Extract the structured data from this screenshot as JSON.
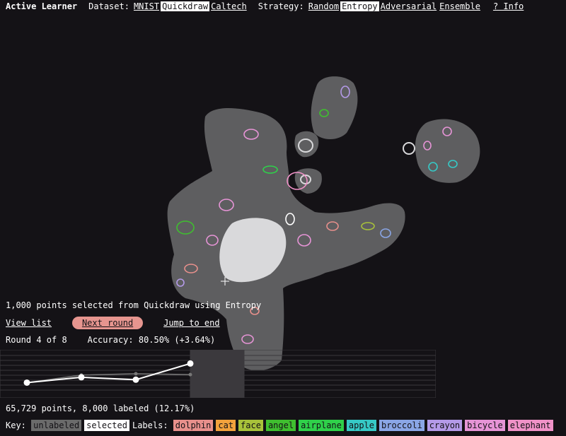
{
  "app": {
    "title": "Active Learner"
  },
  "dataset": {
    "label": "Dataset:",
    "options": [
      "MNIST",
      "Quickdraw",
      "Caltech"
    ],
    "active": "Quickdraw"
  },
  "strategy": {
    "label": "Strategy:",
    "options": [
      "Random",
      "Entropy",
      "Adversarial",
      "Ensemble"
    ],
    "active": "Entropy"
  },
  "info": {
    "label": "? Info"
  },
  "status": {
    "message": "1,000 points selected from Quickdraw using Entropy",
    "view_list": "View list",
    "next_round": "Next round",
    "jump_to_end": "Jump to end",
    "round": "Round 4 of 8",
    "accuracy": "Accuracy: 80.50% (+3.64%)",
    "summary": "65,729 points, 8,000 labeled (12.17%)"
  },
  "history": {
    "rounds_total": 8,
    "current_round": 4,
    "accuracy_series": [
      76.2,
      77.4,
      76.86,
      80.5
    ],
    "ghost_series": [
      76.2,
      77.9,
      78.2,
      78.0
    ]
  },
  "legend": {
    "key_label": "Key:",
    "unlabeled": "unlabeled",
    "selected": "selected",
    "labels_label": "Labels:",
    "unlabeled_color": "#6b6b6b",
    "selected_color": "#ffffff",
    "labels": [
      {
        "name": "dolphin",
        "color": "#e8908c"
      },
      {
        "name": "cat",
        "color": "#f2a23c"
      },
      {
        "name": "face",
        "color": "#a8c23a"
      },
      {
        "name": "angel",
        "color": "#3fbf2f"
      },
      {
        "name": "airplane",
        "color": "#2fd14a"
      },
      {
        "name": "apple",
        "color": "#36c9c6"
      },
      {
        "name": "broccoli",
        "color": "#8aa6e6"
      },
      {
        "name": "crayon",
        "color": "#b49ae8"
      },
      {
        "name": "bicycle",
        "color": "#e694d6"
      },
      {
        "name": "elephant",
        "color": "#f092c8"
      }
    ]
  },
  "colors": {
    "background": "#141216",
    "cluster": "#5e5e60",
    "selected_blob": "#d9d9db",
    "accent": "#e6958f"
  }
}
